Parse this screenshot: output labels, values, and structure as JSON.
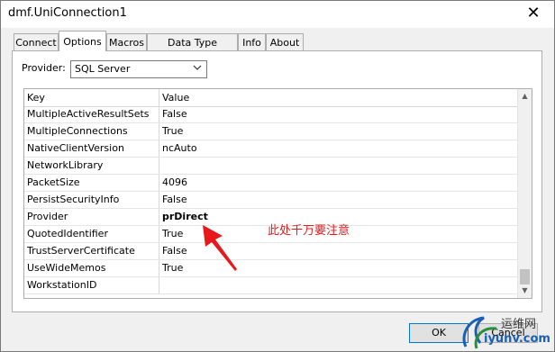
{
  "window": {
    "title": "dmf.UniConnection1",
    "close_glyph": "✕"
  },
  "tabs": [
    {
      "label": "Connect",
      "active": false
    },
    {
      "label": "Options",
      "active": true
    },
    {
      "label": "Macros",
      "active": false
    },
    {
      "label": "Data Type Mapping",
      "active": false
    },
    {
      "label": "Info",
      "active": false
    },
    {
      "label": "About",
      "active": false
    }
  ],
  "provider": {
    "label": "Provider:",
    "value": "SQL Server"
  },
  "grid": {
    "columns": {
      "key": "Key",
      "value": "Value"
    },
    "rows": [
      {
        "key": "MultipleActiveResultSets",
        "value": "False"
      },
      {
        "key": "MultipleConnections",
        "value": "True"
      },
      {
        "key": "NativeClientVersion",
        "value": "ncAuto"
      },
      {
        "key": "NetworkLibrary",
        "value": ""
      },
      {
        "key": "PacketSize",
        "value": "4096"
      },
      {
        "key": "PersistSecurityInfo",
        "value": "False"
      },
      {
        "key": "Provider",
        "value": "prDirect"
      },
      {
        "key": "QuotedIdentifier",
        "value": "True"
      },
      {
        "key": "TrustServerCertificate",
        "value": "False"
      },
      {
        "key": "UseWideMemos",
        "value": "True"
      },
      {
        "key": "WorkstationID",
        "value": ""
      }
    ]
  },
  "annotation": {
    "text": "此处千万要注意",
    "color": "#e8191b"
  },
  "buttons": {
    "ok": "OK",
    "cancel": "Cancel"
  },
  "watermark": {
    "line1": "运维网",
    "line2": "iyunv.com"
  },
  "icons": {
    "dropdown": "chevron-down-icon",
    "scroll_up": "scroll-up-icon",
    "scroll_down": "scroll-down-icon"
  }
}
